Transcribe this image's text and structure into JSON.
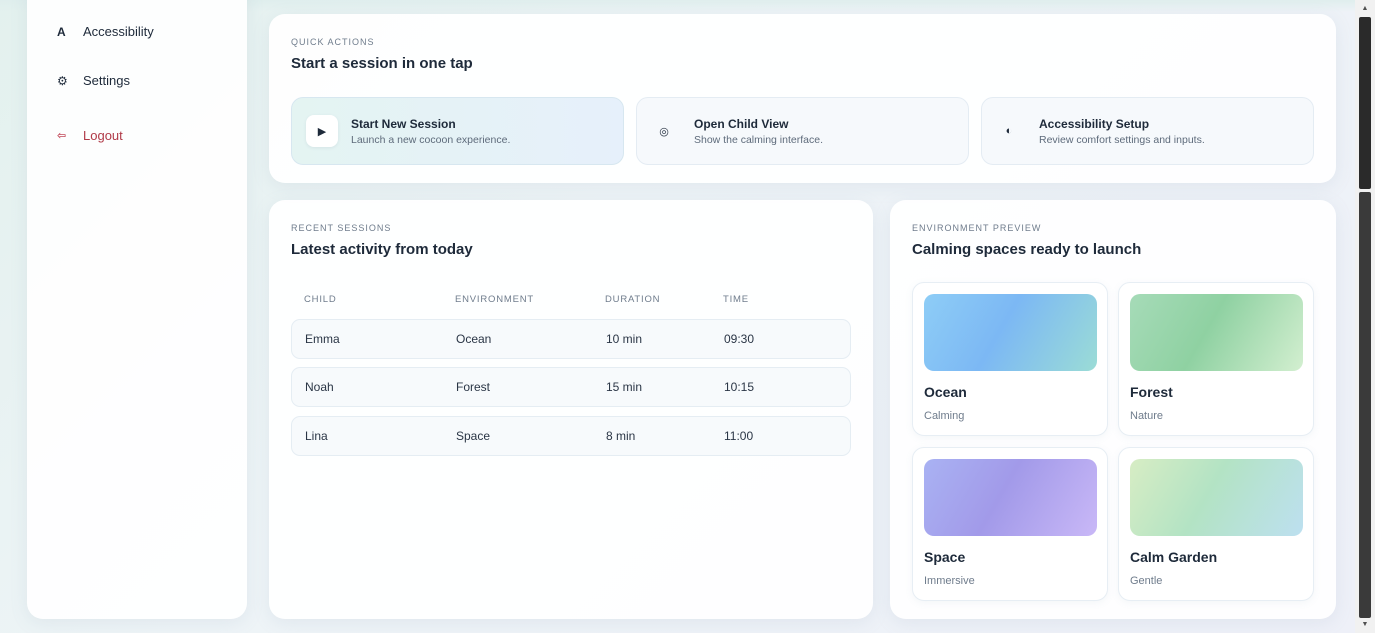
{
  "sidebar": {
    "items": [
      {
        "icon": "A",
        "label": "Accessibility"
      },
      {
        "icon": "⚙",
        "label": "Settings"
      },
      {
        "icon": "⇦",
        "label": "Logout"
      }
    ]
  },
  "quick_actions": {
    "eyebrow": "QUICK ACTIONS",
    "title": "Start a session in one tap",
    "items": [
      {
        "icon": "▶",
        "title": "Start New Session",
        "subtitle": "Launch a new cocoon experience."
      },
      {
        "icon": "◎",
        "title": "Open Child View",
        "subtitle": "Show the calming interface."
      },
      {
        "icon": "◐",
        "title": "Accessibility Setup",
        "subtitle": "Review comfort settings and inputs."
      }
    ]
  },
  "recent_sessions": {
    "eyebrow": "RECENT SESSIONS",
    "title": "Latest activity from today",
    "columns": [
      "CHILD",
      "ENVIRONMENT",
      "DURATION",
      "TIME"
    ],
    "rows": [
      [
        "Emma",
        "Ocean",
        "10 min",
        "09:30"
      ],
      [
        "Noah",
        "Forest",
        "15 min",
        "10:15"
      ],
      [
        "Lina",
        "Space",
        "8 min",
        "11:00"
      ]
    ]
  },
  "environment_preview": {
    "eyebrow": "ENVIRONMENT PREVIEW",
    "title": "Calming spaces ready to launch",
    "items": [
      {
        "name": "Ocean",
        "tag": "Calming",
        "colors": [
          "#8ecdf6",
          "#7cb8f4",
          "#9bdcd6"
        ]
      },
      {
        "name": "Forest",
        "tag": "Nature",
        "colors": [
          "#a6dbb8",
          "#8fd1a2",
          "#d3efd0"
        ]
      },
      {
        "name": "Space",
        "tag": "Immersive",
        "colors": [
          "#a9b2f3",
          "#a29ae9",
          "#c9b8f7"
        ]
      },
      {
        "name": "Calm Garden",
        "tag": "Gentle",
        "colors": [
          "#d7edc4",
          "#b3e3c4",
          "#bde0f0"
        ]
      }
    ]
  },
  "theme": {
    "accent": "#1e2a3a",
    "logout": "#b03a48"
  }
}
